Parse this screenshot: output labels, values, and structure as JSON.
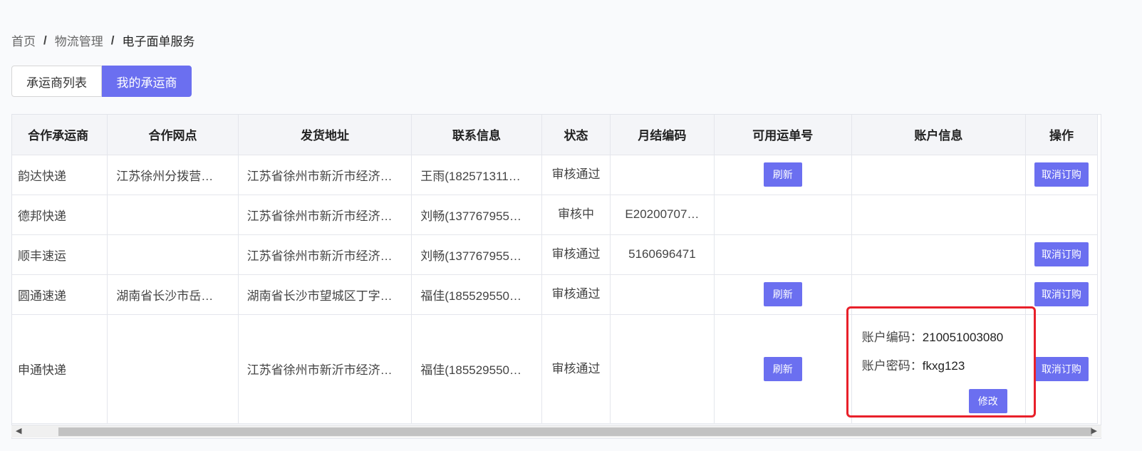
{
  "breadcrumb": {
    "home": "首页",
    "section": "物流管理",
    "current": "电子面单服务",
    "separator": "/"
  },
  "tabs": [
    {
      "label": "承运商列表",
      "active": false
    },
    {
      "label": "我的承运商",
      "active": true
    }
  ],
  "table": {
    "columns": [
      "合作承运商",
      "合作网点",
      "发货地址",
      "联系信息",
      "状态",
      "月结编码",
      "可用运单号",
      "账户信息",
      "操作"
    ],
    "rows": [
      {
        "carrier": "韵达快递",
        "branch": "江苏徐州分拨营…",
        "address": "江苏省徐州市新沂市经济…",
        "contact": "王雨(182571311…",
        "status": "审核通过",
        "monthly_code": "",
        "refresh": "刷新",
        "account": null,
        "action": "取消订购"
      },
      {
        "carrier": "德邦快递",
        "branch": "",
        "address": "江苏省徐州市新沂市经济…",
        "contact": "刘畅(137767955…",
        "status": "审核中",
        "monthly_code": "E20200707…",
        "refresh": "",
        "account": null,
        "action": ""
      },
      {
        "carrier": "顺丰速运",
        "branch": "",
        "address": "江苏省徐州市新沂市经济…",
        "contact": "刘畅(137767955…",
        "status": "审核通过",
        "monthly_code": "5160696471",
        "refresh": "",
        "account": null,
        "action": "取消订购"
      },
      {
        "carrier": "圆通速递",
        "branch": "湖南省长沙市岳…",
        "address": "湖南省长沙市望城区丁字…",
        "contact": "福佳(185529550…",
        "status": "审核通过",
        "monthly_code": "",
        "refresh": "刷新",
        "account": null,
        "action": "取消订购"
      },
      {
        "carrier": "申通快递",
        "branch": "",
        "address": "江苏省徐州市新沂市经济…",
        "contact": "福佳(185529550…",
        "status": "审核通过",
        "monthly_code": "",
        "refresh": "刷新",
        "account": {
          "code_label": "账户编码：",
          "code_value": "210051003080",
          "password_label": "账户密码：",
          "password_value": "fkxg123",
          "modify_label": "修改"
        },
        "action": "取消订购"
      }
    ]
  },
  "colors": {
    "accent": "#6b6ff0",
    "highlight_frame": "#e8202a",
    "header_bg": "#f4f5f8"
  }
}
